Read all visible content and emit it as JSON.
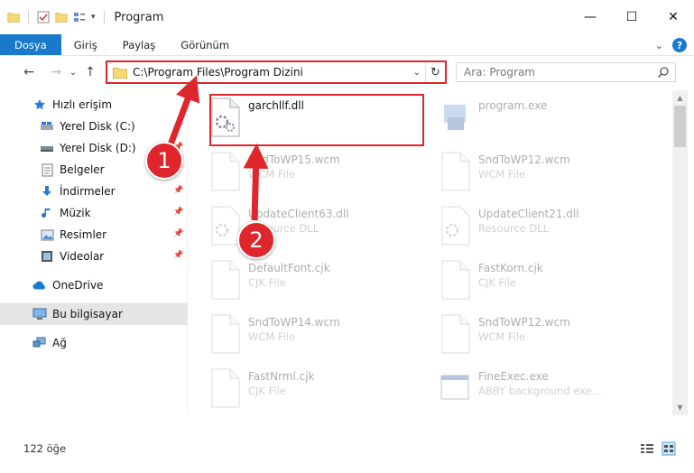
{
  "window": {
    "title": "Program",
    "controls": {
      "minimize": "—",
      "maximize": "☐",
      "close": "✕"
    }
  },
  "ribbon": {
    "tabs": [
      "Dosya",
      "Giriş",
      "Paylaş",
      "Görünüm"
    ],
    "chevron": "⌄",
    "help": "?"
  },
  "nav": {
    "back": "←",
    "forward": "→",
    "recent": "⌄",
    "up": "↑",
    "address": "C:\\Program Files\\Program Dizini",
    "address_dropdown": "⌄",
    "refresh": "↻",
    "search_placeholder": "Ara: Program"
  },
  "sidebar": {
    "items": [
      {
        "label": "Hızlı erişim",
        "icon": "star-icon",
        "pinned": false
      },
      {
        "label": "Yerel Disk (C:)",
        "icon": "drive-icon",
        "pinned": true
      },
      {
        "label": "Yerel Disk (D:)",
        "icon": "drive-icon",
        "pinned": true
      },
      {
        "label": "Belgeler",
        "icon": "documents-icon",
        "pinned": true
      },
      {
        "label": "İndirmeler",
        "icon": "download-icon",
        "pinned": true
      },
      {
        "label": "Müzik",
        "icon": "music-icon",
        "pinned": true
      },
      {
        "label": "Resimler",
        "icon": "pictures-icon",
        "pinned": true
      },
      {
        "label": "Videolar",
        "icon": "video-icon",
        "pinned": true
      },
      {
        "label": "OneDrive",
        "icon": "cloud-icon",
        "pinned": false
      },
      {
        "label": "Bu bilgisayar",
        "icon": "computer-icon",
        "pinned": false,
        "selected": true
      },
      {
        "label": "Ağ",
        "icon": "network-icon",
        "pinned": false
      }
    ]
  },
  "files": [
    {
      "name": "garchllf.dll",
      "type": "",
      "icon": "dll-file-icon",
      "highlighted": true
    },
    {
      "name": "program.exe",
      "type": "",
      "icon": "exe-file-icon",
      "highlighted": false
    },
    {
      "name": "SndToWP15.wcm",
      "type": "WCM File",
      "icon": "generic-file-icon",
      "highlighted": false
    },
    {
      "name": "SndToWP12.wcm",
      "type": "WCM File",
      "icon": "generic-file-icon",
      "highlighted": false
    },
    {
      "name": "UpdateClient63.dll",
      "type": "Resource DLL",
      "icon": "dll-file-icon",
      "highlighted": false
    },
    {
      "name": "UpdateClient21.dll",
      "type": "Resource DLL",
      "icon": "dll-file-icon",
      "highlighted": false
    },
    {
      "name": "DefaultFont.cjk",
      "type": "CJK File",
      "icon": "generic-file-icon",
      "highlighted": false
    },
    {
      "name": "FastKorn.cjk",
      "type": "CJK File",
      "icon": "generic-file-icon",
      "highlighted": false
    },
    {
      "name": "SndToWP14.wcm",
      "type": "WCM File",
      "icon": "generic-file-icon",
      "highlighted": false
    },
    {
      "name": "SndToWP12.wcm",
      "type": "WCM File",
      "icon": "generic-file-icon",
      "highlighted": false
    },
    {
      "name": "FastNrml.cjk",
      "type": "CJK File",
      "icon": "generic-file-icon",
      "highlighted": false
    },
    {
      "name": "FineExec.exe",
      "type": "ABBY background exe...",
      "icon": "window-file-icon",
      "highlighted": false
    }
  ],
  "status": {
    "item_count": "122 öğe"
  },
  "annotations": {
    "step1": "1",
    "step2": "2",
    "color": "#e0262d"
  }
}
